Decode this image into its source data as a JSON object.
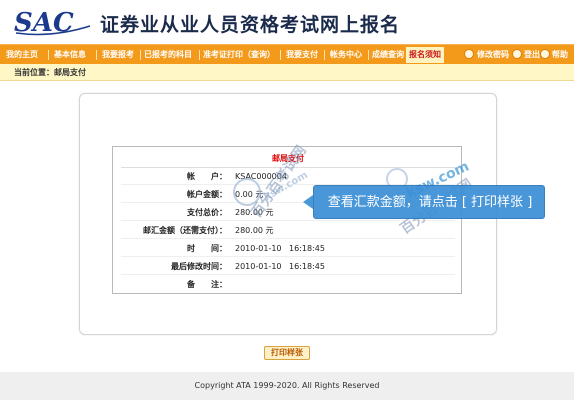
{
  "header": {
    "logo_text": "SAC",
    "site_title": "证券业从业人员资格考试网上报名"
  },
  "nav": {
    "items": [
      {
        "label": "我的主页"
      },
      {
        "label": "基本信息"
      },
      {
        "label": "我要报考"
      },
      {
        "label": "已报考的科目"
      },
      {
        "label": "准考证打印（查询）"
      },
      {
        "label": "我要支付"
      },
      {
        "label": "帐务中心"
      },
      {
        "label": "成绩查询"
      },
      {
        "label": "报名须知"
      }
    ],
    "active_index": 8,
    "right": [
      {
        "label": "修改密码",
        "icon": "key-icon"
      },
      {
        "label": "登出",
        "icon": "logout-icon"
      },
      {
        "label": "帮助",
        "icon": "help-icon"
      }
    ]
  },
  "breadcrumb": "当前位置：邮局支付",
  "info": {
    "title": "邮局支付",
    "rows": [
      {
        "label": "帐　　户：",
        "value": "KSAC000004",
        "time": ""
      },
      {
        "label": "帐户金额：",
        "value": "0.00 元",
        "time": ""
      },
      {
        "label": "支付总价：",
        "value": "280.00 元",
        "time": ""
      },
      {
        "label": "邮汇金额（还需支付）：",
        "value": "280.00 元",
        "time": ""
      },
      {
        "label": "时　　间：",
        "value": "2010-01-10",
        "time": "16:18:45"
      },
      {
        "label": "最后修改时间：",
        "value": "2010-01-10",
        "time": "16:18:45"
      },
      {
        "label": "备　　注：",
        "value": "",
        "time": ""
      }
    ]
  },
  "watermark": {
    "text": "百分百考试网",
    "site": "ksw.com"
  },
  "callout": {
    "text": "查看汇款金额，请点击 [ 打印样张 ]"
  },
  "print_button": "打印样张",
  "footer": "Copyright ATA 1999-2020. All Rights Reserved",
  "colors": {
    "nav_bg": "#f39a1a",
    "breadcrumb_bg": "#fff7c6",
    "title_red": "#e00000",
    "callout_bg": "#3a8fd6"
  }
}
